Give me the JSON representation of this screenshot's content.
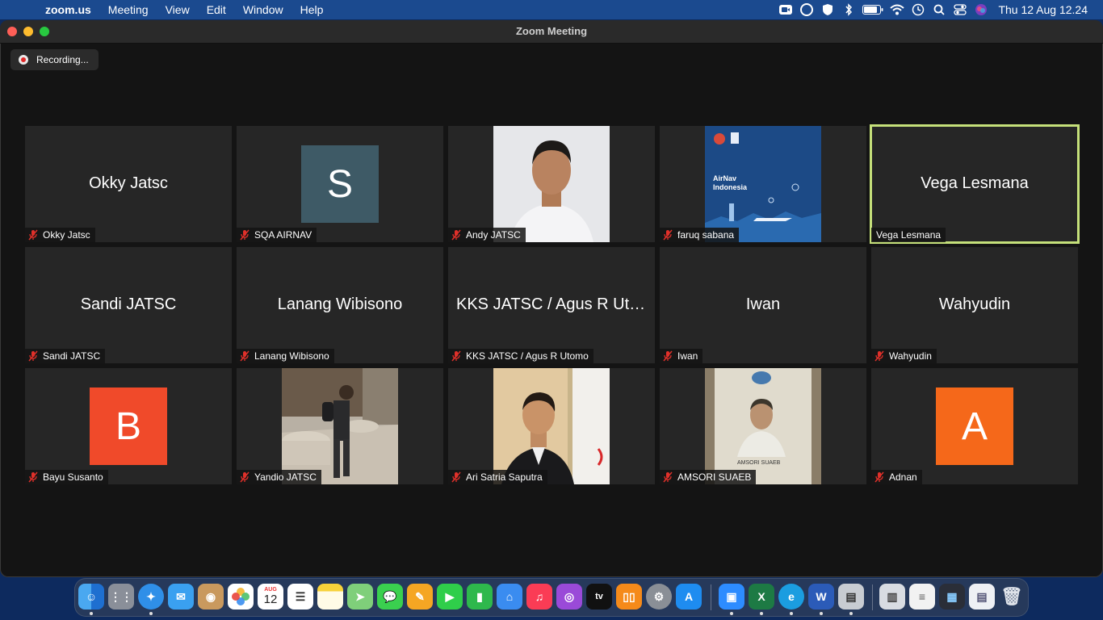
{
  "menubar": {
    "apple_glyph": "",
    "items": [
      "zoom.us",
      "Meeting",
      "View",
      "Edit",
      "Window",
      "Help"
    ],
    "clock": "Thu 12 Aug  12.24"
  },
  "window": {
    "title": "Zoom Meeting"
  },
  "recording": {
    "label": "Recording..."
  },
  "participants": [
    {
      "name": "Okky Jatsc",
      "display": "Okky Jatsc",
      "kind": "name",
      "active": false
    },
    {
      "name": "SQA AIRNAV",
      "display": "S",
      "kind": "avatar",
      "avatar_color": "#3e5a66",
      "active": false
    },
    {
      "name": "Andy JATSC",
      "display": "",
      "kind": "video",
      "active": false
    },
    {
      "name": "faruq sabana",
      "display": "",
      "kind": "video",
      "active": false
    },
    {
      "name": "Vega Lesmana",
      "display": "Vega Lesmana",
      "kind": "name",
      "active": true
    },
    {
      "name": "Sandi JATSC",
      "display": "Sandi JATSC",
      "kind": "name",
      "active": false
    },
    {
      "name": "Lanang Wibisono",
      "display": "Lanang Wibisono",
      "kind": "name",
      "active": false
    },
    {
      "name": "KKS JATSC / Agus R Utomo",
      "display": "KKS JATSC / Agus R Uto...",
      "kind": "name",
      "active": false
    },
    {
      "name": "Iwan",
      "display": "Iwan",
      "kind": "name",
      "active": false
    },
    {
      "name": "Wahyudin",
      "display": "Wahyudin",
      "kind": "name",
      "active": false
    },
    {
      "name": "Bayu Susanto",
      "display": "B",
      "kind": "avatar",
      "avatar_color": "#f04a2a",
      "active": false
    },
    {
      "name": "Yandio JATSC",
      "display": "",
      "kind": "video",
      "active": false
    },
    {
      "name": "Ari Satria Saputra",
      "display": "",
      "kind": "video",
      "active": false
    },
    {
      "name": "AMSORI SUAEB",
      "display": "",
      "kind": "video",
      "active": false
    },
    {
      "name": "Adnan",
      "display": "A",
      "kind": "avatar",
      "avatar_color": "#f5681a",
      "active": false
    }
  ],
  "video_text": {
    "faruq_brand": "AirNav Indonesia",
    "amsori_caption": "AMSORI SUAEB"
  },
  "dock": {
    "calendar_month": "AUG",
    "calendar_day": "12",
    "tv_label": "tv"
  },
  "colors": {
    "active_border": "#c5e07a",
    "muted_mic": "#e0302a",
    "tile_bg": "#262626"
  }
}
